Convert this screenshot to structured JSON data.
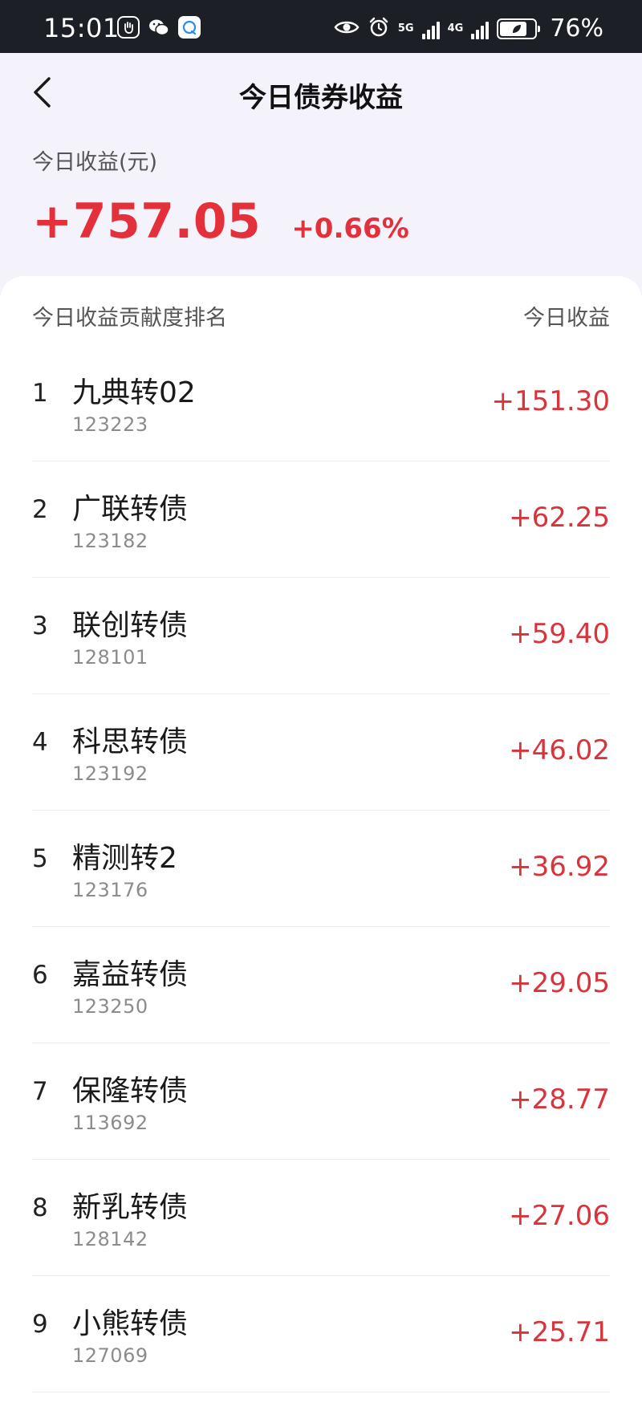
{
  "status_bar": {
    "time": "15:01",
    "network_1": "5G",
    "network_2": "4G",
    "battery": "76%"
  },
  "header": {
    "title": "今日债券收益"
  },
  "summary": {
    "label": "今日收益(元)",
    "amount": "+757.05",
    "percent": "+0.66%"
  },
  "list": {
    "header_left": "今日收益贡献度排名",
    "header_right": "今日收益",
    "items": [
      {
        "rank": "1",
        "name": "九典转02",
        "code": "123223",
        "gain": "+151.30"
      },
      {
        "rank": "2",
        "name": "广联转债",
        "code": "123182",
        "gain": "+62.25"
      },
      {
        "rank": "3",
        "name": "联创转债",
        "code": "128101",
        "gain": "+59.40"
      },
      {
        "rank": "4",
        "name": "科思转债",
        "code": "123192",
        "gain": "+46.02"
      },
      {
        "rank": "5",
        "name": "精测转2",
        "code": "123176",
        "gain": "+36.92"
      },
      {
        "rank": "6",
        "name": "嘉益转债",
        "code": "123250",
        "gain": "+29.05"
      },
      {
        "rank": "7",
        "name": "保隆转债",
        "code": "113692",
        "gain": "+28.77"
      },
      {
        "rank": "8",
        "name": "新乳转债",
        "code": "128142",
        "gain": "+27.06"
      },
      {
        "rank": "9",
        "name": "小熊转债",
        "code": "127069",
        "gain": "+25.71"
      }
    ]
  },
  "colors": {
    "positive": "#e3303a",
    "status_bar_bg": "#1c1f26",
    "page_bg": "#f4f3fb"
  }
}
